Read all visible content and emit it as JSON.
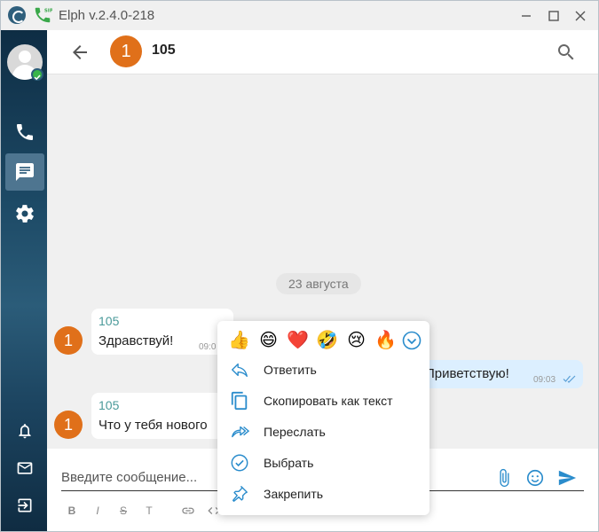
{
  "window": {
    "title": "Elph v.2.4.0-218"
  },
  "header": {
    "avatar_letter": "1",
    "title": "105"
  },
  "messages": {
    "date_separator": "23 августа",
    "items": [
      {
        "direction": "in",
        "avatar_letter": "1",
        "sender": "105",
        "text": "Здравствуй!",
        "time": "09:0"
      },
      {
        "direction": "out",
        "text": "Приветствую!",
        "time": "09:03",
        "status": "read"
      },
      {
        "direction": "in",
        "avatar_letter": "1",
        "sender": "105",
        "text": "Что у тебя нового"
      }
    ]
  },
  "composer": {
    "placeholder": "Введите сообщение...",
    "format_buttons": [
      "B",
      "I",
      "S",
      "T"
    ]
  },
  "context_menu": {
    "reactions": [
      "👍",
      "😄",
      "❤️",
      "🤣",
      "😢",
      "🔥"
    ],
    "items": [
      {
        "icon": "reply-icon",
        "label": "Ответить"
      },
      {
        "icon": "copy-icon",
        "label": "Скопировать как текст"
      },
      {
        "icon": "forward-icon",
        "label": "Переслать"
      },
      {
        "icon": "select-icon",
        "label": "Выбрать"
      },
      {
        "icon": "pin-icon",
        "label": "Закрепить"
      }
    ]
  },
  "colors": {
    "accent": "#2a8ccc",
    "avatar_orange": "#e0701a",
    "sender_teal": "#4a9a9a",
    "outgoing_bubble": "#dcefff",
    "online_green": "#39b54a"
  }
}
